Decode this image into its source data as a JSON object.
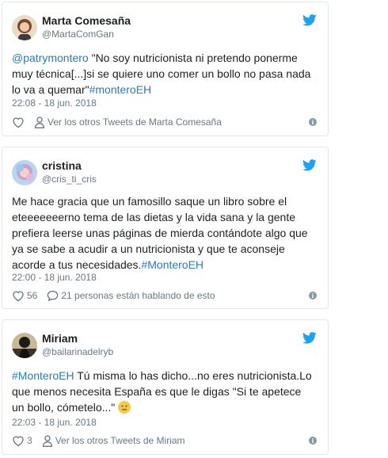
{
  "tweets": [
    {
      "name": "Marta Comesaña",
      "handle": "@MartaComGan",
      "text_parts": [
        "@patrymontero",
        " \"No soy nutricionista ni pretendo ponerme muy técnica[...]si se quiere uno comer un bollo no pasa nada lo va a quemar\"",
        "#monteroEH"
      ],
      "time": "22:08 - 18 jun. 2018",
      "likes": "",
      "action_label": "Ver los otros Tweets de Marta Comesaña"
    },
    {
      "name": "cristina",
      "handle": "@cris_ti_cris",
      "text_parts": [
        "Me hace gracia que un famosillo saque un libro sobre el eteeeeeeerno tema de las dietas y la vida sana y la gente prefiera leerse unas páginas de mierda contándote algo que ya se sabe a acudir a un nutricionista y que te aconseje acorde a tus necesidades.",
        "#MonteroEH"
      ],
      "time": "22:00 - 18 jun. 2018",
      "likes": "56",
      "action_label": "21 personas están hablando de esto"
    },
    {
      "name": "Miriam",
      "handle": "@bailarinadelryb",
      "text_parts": [
        "#MonteroEH",
        " Tú misma lo has dicho...no eres nutricionista.Lo que menos necesita España es que le digas \"Si te apetece un bollo, cómetelo...\" "
      ],
      "time": "22:03 - 18 jun. 2018",
      "likes": "3",
      "action_label": "Ver los otros Tweets de Miriam"
    }
  ],
  "colors": {
    "link": "#2b7bb9",
    "twitter_blue": "#1da1f2",
    "muted": "#697882",
    "border": "#e1e8ed"
  },
  "icons": {
    "brand": "twitter-bird-icon",
    "like": "heart-icon",
    "profile": "person-icon",
    "reply": "speech-bubble-icon",
    "info": "info-icon",
    "emoji": "neutral-face-emoji"
  }
}
